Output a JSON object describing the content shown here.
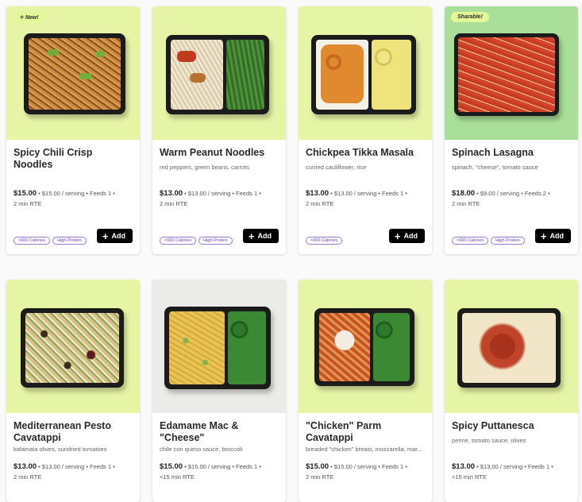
{
  "add_label": "Add",
  "cards": [
    {
      "badge": "New!",
      "title": "Spicy Chili Crisp Noodles",
      "subtitle": "",
      "price": "$15.00",
      "meta1": "• $15.00 / serving • Feeds 1 •",
      "meta2": "2 min RTE",
      "tags": [
        "<600 Calories",
        "High-Protein"
      ],
      "bg": "#e6f5a5"
    },
    {
      "badge": "",
      "title": "Warm Peanut Noodles",
      "subtitle": "red peppers, green beans, carrots",
      "price": "$13.00",
      "meta1": "• $13.00 / serving • Feeds 1 •",
      "meta2": "2 min RTE",
      "tags": [
        "<600 Calories",
        "High-Protein"
      ],
      "bg": "#e6f5a5"
    },
    {
      "badge": "",
      "title": "Chickpea Tikka Masala",
      "subtitle": "curried cauliflower, rice",
      "price": "$13.00",
      "meta1": "• $13.00 / serving • Feeds 1 •",
      "meta2": "2 min RTE",
      "tags": [
        "<600 Calories"
      ],
      "bg": "#e6f5a5"
    },
    {
      "badge": "Sharable!",
      "title": "Spinach Lasagna",
      "subtitle": "spinach, \"cheese\", tomato sauce",
      "price": "$18.00",
      "meta1": "• $9.00 / serving • Feeds 2 •",
      "meta2": "2 min RTE",
      "tags": [
        "<600 Calories",
        "High-Protein"
      ],
      "bg": "#a9df98"
    },
    {
      "badge": "",
      "title": "Mediterranean Pesto Cavatappi",
      "subtitle": "kalamata olives, sundried tomatoes",
      "price": "$13.00",
      "meta1": "• $13.00 / serving • Feeds 1 •",
      "meta2": "2 min RTE",
      "bg": "#e6f5a5"
    },
    {
      "badge": "",
      "title": "Edamame Mac & \"Cheese\"",
      "subtitle": "chile con queso sauce, broccoli",
      "price": "$15.00",
      "meta1": "• $15.00 / serving • Feeds 1 •",
      "meta2": "<15 min RTE",
      "bg": "#ebebea"
    },
    {
      "badge": "",
      "title": "\"Chicken\" Parm Cavatappi",
      "subtitle": "breaded \"chicken\" breast, mozzarella, mar...",
      "price": "$15.00",
      "meta1": "• $15.00 / serving • Feeds 1 •",
      "meta2": "2 min RTE",
      "bg": "#e6f5a5"
    },
    {
      "badge": "",
      "title": "Spicy Puttanesca",
      "subtitle": "penne, tomato sauce, olives",
      "price": "$13.00",
      "meta1": "• $13.00 / serving • Feeds 1 •",
      "meta2": "<15 min RTE",
      "bg": "#e6f5a5"
    }
  ]
}
